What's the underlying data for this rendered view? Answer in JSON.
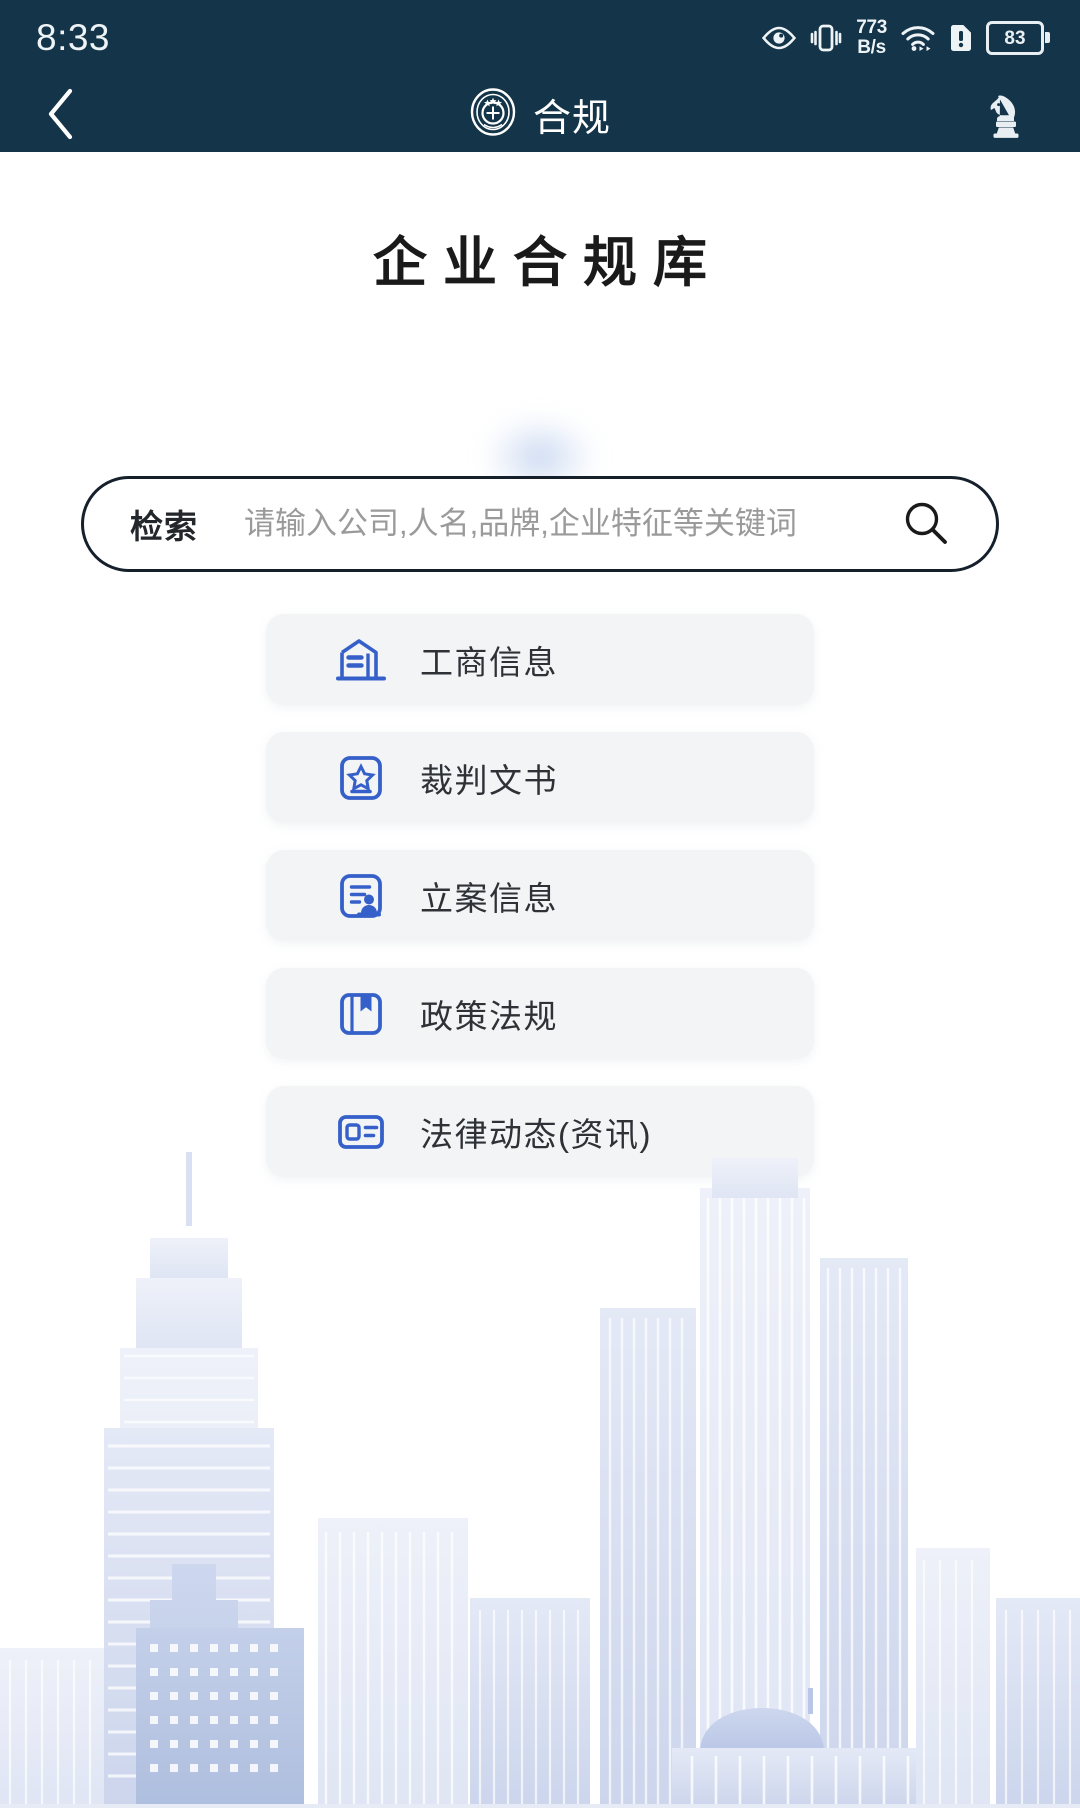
{
  "statusbar": {
    "time": "8:33",
    "network_speed_value": "773",
    "network_speed_unit": "B/s",
    "battery_percent": "83",
    "icons": [
      "eye-icon",
      "vibrate-icon",
      "wifi-icon",
      "sim-alert-icon",
      "battery-icon"
    ]
  },
  "navbar": {
    "title": "合规",
    "back_icon": "chevron-left-icon",
    "logo_icon": "court-emblem-icon",
    "right_icon": "chess-knight-icon"
  },
  "page": {
    "title": "企业合规库"
  },
  "search": {
    "label": "检索",
    "placeholder": "请输入公司,人名,品牌,企业特征等关键词",
    "value": "",
    "icon": "search-icon"
  },
  "menu": {
    "items": [
      {
        "label": "工商信息",
        "icon": "building-icon"
      },
      {
        "label": "裁判文书",
        "icon": "star-document-icon"
      },
      {
        "label": "立案信息",
        "icon": "case-file-icon"
      },
      {
        "label": "政策法规",
        "icon": "book-bookmark-icon"
      },
      {
        "label": "法律动态(资讯)",
        "icon": "news-card-icon"
      }
    ]
  },
  "colors": {
    "header_bg": "#143449",
    "accent_blue": "#3660c9",
    "card_bg": "#f3f4f6",
    "text_dark": "#2e3237",
    "placeholder": "#9a9a9a",
    "skyline_light": "#e9ecf7",
    "skyline_mid": "#d7def0",
    "skyline_accent": "#c3cdea"
  }
}
